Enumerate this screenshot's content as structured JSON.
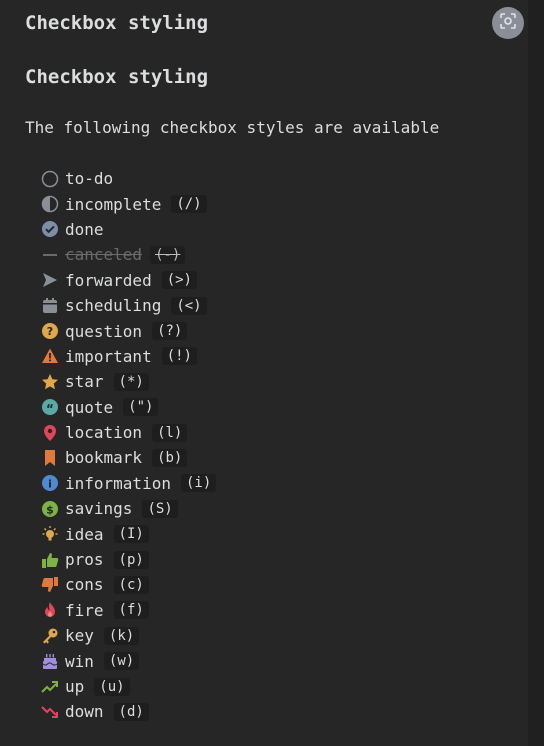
{
  "header": {
    "title": "Checkbox styling"
  },
  "section": {
    "heading": "Checkbox styling",
    "intro": "The following checkbox styles are available"
  },
  "items": [
    {
      "label": "to-do",
      "code": "",
      "icon": "empty-circle-icon"
    },
    {
      "label": "incomplete",
      "code": "(/)",
      "icon": "half-circle-icon"
    },
    {
      "label": "done",
      "code": "",
      "icon": "check-circle-icon"
    },
    {
      "label": "canceled",
      "code": "(-)",
      "icon": "dash-icon"
    },
    {
      "label": "forwarded",
      "code": "(>)",
      "icon": "send-arrow-icon"
    },
    {
      "label": "scheduling",
      "code": "(<)",
      "icon": "calendar-icon"
    },
    {
      "label": "question",
      "code": "(?)",
      "icon": "question-circle-icon"
    },
    {
      "label": "important",
      "code": "(!)",
      "icon": "warning-triangle-icon"
    },
    {
      "label": "star",
      "code": "(*)",
      "icon": "star-icon"
    },
    {
      "label": "quote",
      "code": "(\")",
      "icon": "quote-icon"
    },
    {
      "label": "location",
      "code": "(l)",
      "icon": "map-pin-icon"
    },
    {
      "label": "bookmark",
      "code": "(b)",
      "icon": "bookmark-icon"
    },
    {
      "label": "information",
      "code": "(i)",
      "icon": "info-circle-icon"
    },
    {
      "label": "savings",
      "code": "(S)",
      "icon": "dollar-circle-icon"
    },
    {
      "label": "idea",
      "code": "(I)",
      "icon": "lightbulb-icon"
    },
    {
      "label": "pros",
      "code": "(p)",
      "icon": "thumbs-up-icon"
    },
    {
      "label": "cons",
      "code": "(c)",
      "icon": "thumbs-down-icon"
    },
    {
      "label": "fire",
      "code": "(f)",
      "icon": "fire-icon"
    },
    {
      "label": "key",
      "code": "(k)",
      "icon": "key-icon"
    },
    {
      "label": "win",
      "code": "(w)",
      "icon": "cake-icon"
    },
    {
      "label": "up",
      "code": "(u)",
      "icon": "trend-up-icon"
    },
    {
      "label": "down",
      "code": "(d)",
      "icon": "trend-down-icon"
    }
  ],
  "colors": {
    "background": "#262626",
    "text": "#dcddde",
    "gray_icon": "#8a8f97",
    "done_blue": "#7d8ea8",
    "question": "#e0a84a",
    "important": "#e0793c",
    "star": "#e0a84a",
    "quote": "#5ca8a8",
    "location": "#e0455a",
    "bookmark": "#e0793c",
    "info": "#4f8ad1",
    "savings": "#7cb342",
    "idea": "#e0a84a",
    "pros": "#7cb342",
    "cons": "#e0793c",
    "fire": "#e0455a",
    "key": "#e0a84a",
    "win": "#a08ee0",
    "up": "#7cb342",
    "down": "#e0455a"
  }
}
